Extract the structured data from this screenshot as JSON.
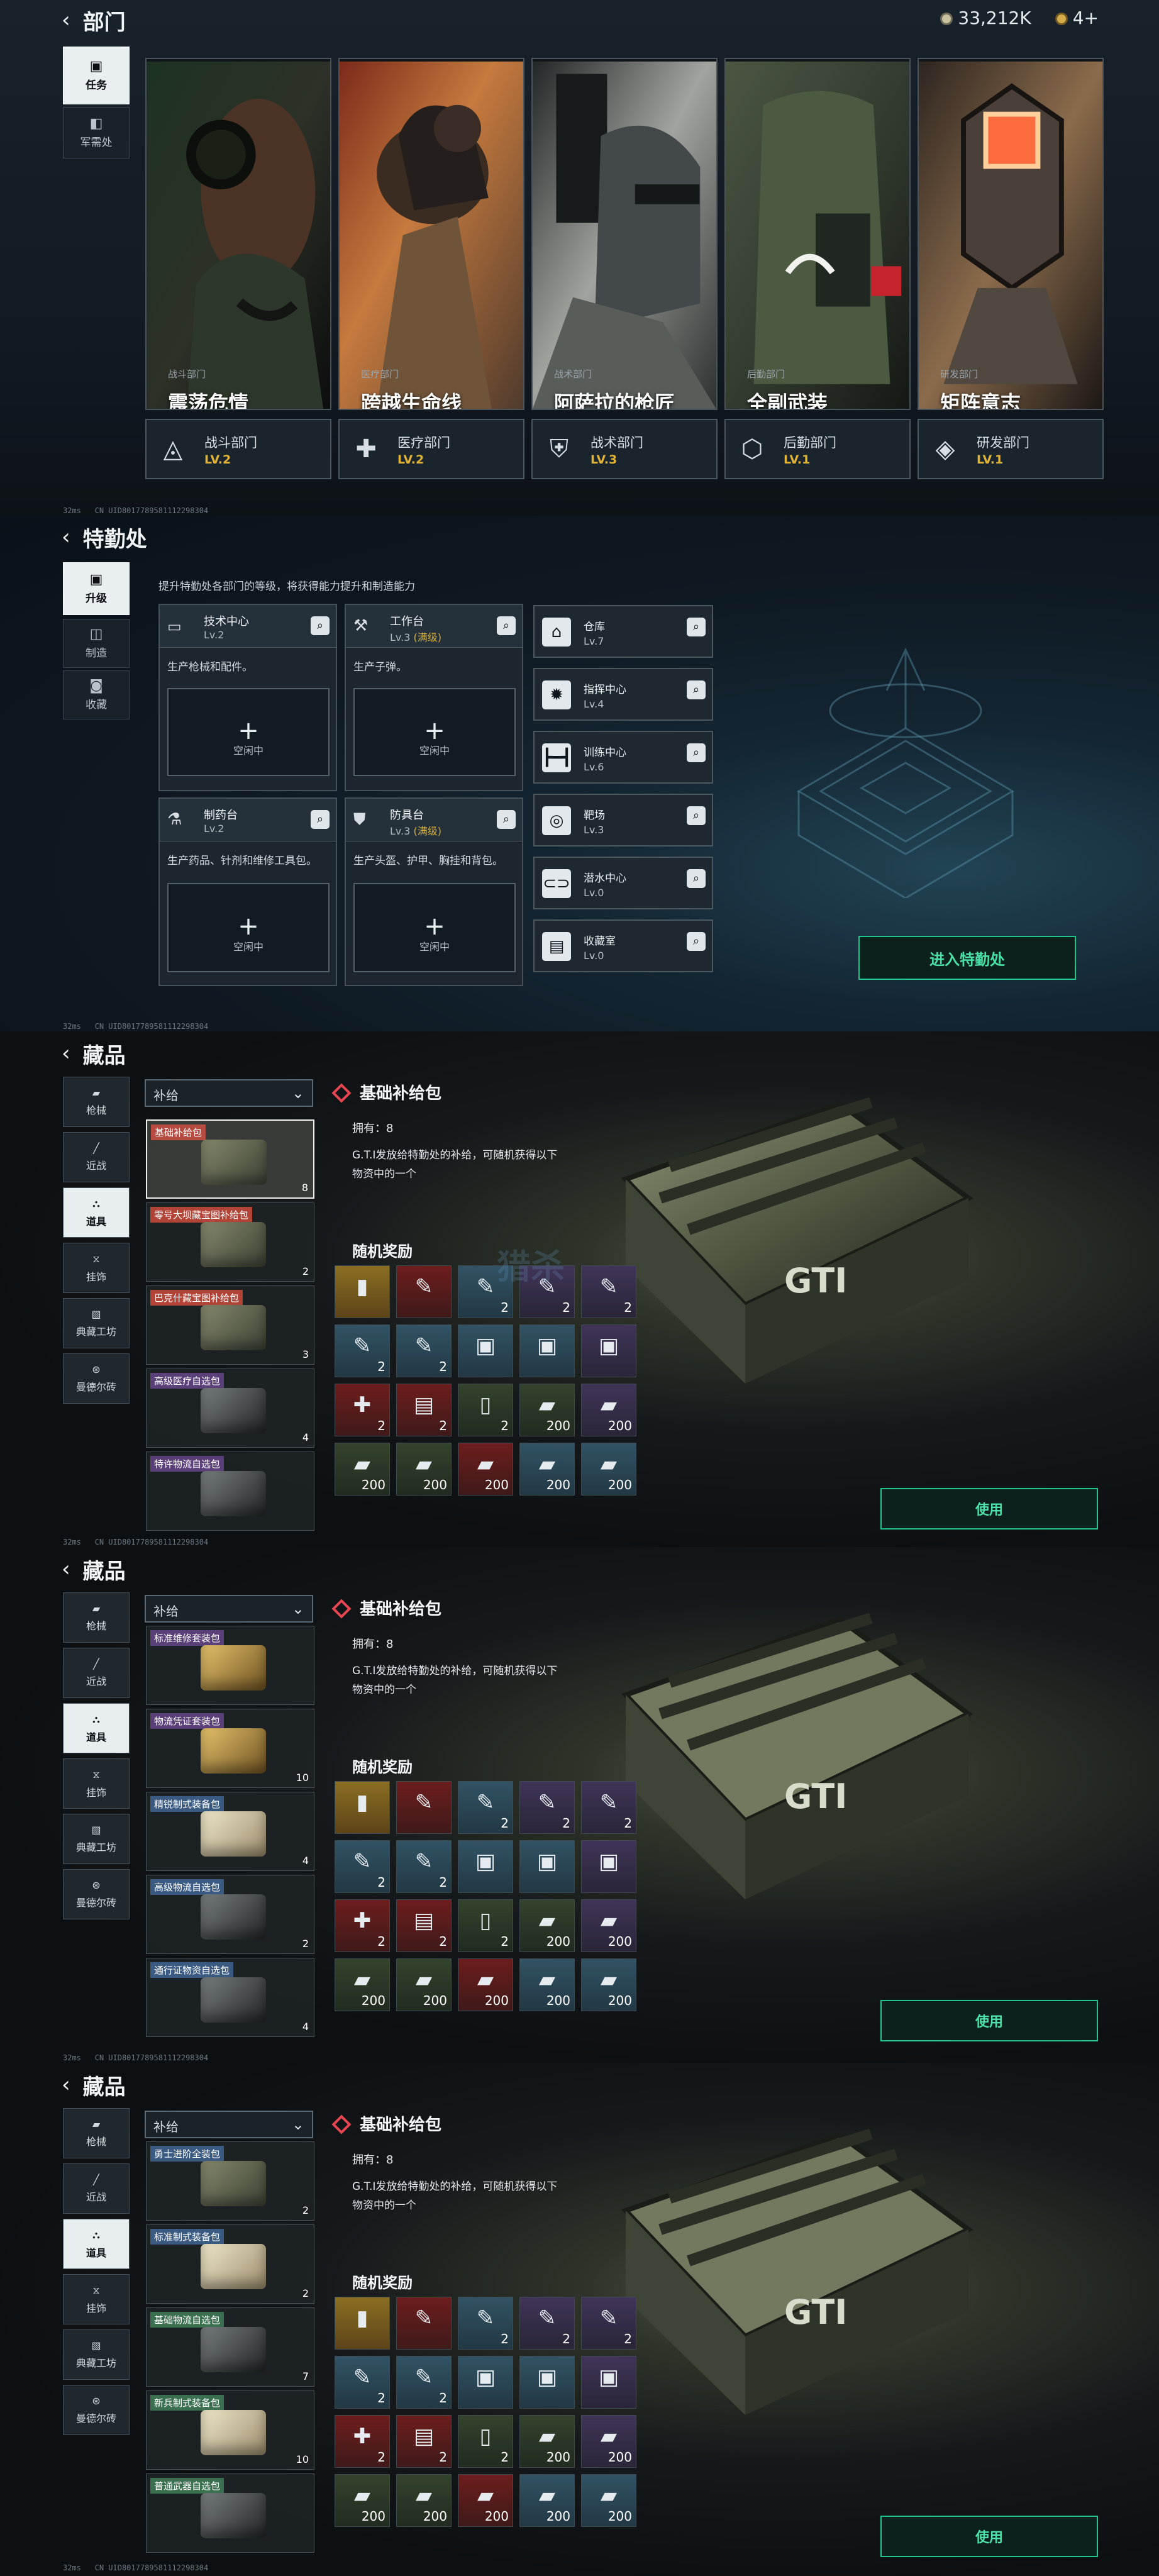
{
  "status": {
    "ping": "32ms",
    "code": "CN UID8017789581112298304"
  },
  "screen1": {
    "title": "部门",
    "currency_silver": "33,212K",
    "currency_gold": "4+",
    "tabs": [
      "任务",
      "军需处"
    ],
    "departments": [
      {
        "small": "战斗部门",
        "mission": "震荡危情",
        "name": "战斗部门",
        "level": "LV.2"
      },
      {
        "small": "医疗部门",
        "mission": "跨越生命线",
        "name": "医疗部门",
        "level": "LV.2"
      },
      {
        "small": "战术部门",
        "mission": "阿萨拉的枪匠",
        "name": "战术部门",
        "level": "LV.3"
      },
      {
        "small": "后勤部门",
        "mission": "全副武装",
        "name": "后勤部门",
        "level": "LV.1"
      },
      {
        "small": "研发部门",
        "mission": "矩阵意志",
        "name": "研发部门",
        "level": "LV.1"
      }
    ]
  },
  "screen2": {
    "title": "特勤处",
    "tabs": [
      "升级",
      "制造",
      "收藏"
    ],
    "intro": "提升特勤处各部门的等级，将获得能力提升和制造能力",
    "main_facilities": [
      {
        "name": "技术中心",
        "level": "Lv.2",
        "max": "",
        "desc": "生产枪械和配件。",
        "idle": "空闲中"
      },
      {
        "name": "工作台",
        "level": "Lv.3",
        "max": "(满级)",
        "desc": "生产子弹。",
        "idle": "空闲中"
      },
      {
        "name": "制药台",
        "level": "Lv.2",
        "max": "",
        "desc": "生产药品、针剂和维修工具包。",
        "idle": "空闲中"
      },
      {
        "name": "防具台",
        "level": "Lv.3",
        "max": "(满级)",
        "desc": "生产头盔、护甲、胸挂和背包。",
        "idle": "空闲中"
      }
    ],
    "small_facilities": [
      {
        "name": "仓库",
        "level": "Lv.7"
      },
      {
        "name": "指挥中心",
        "level": "Lv.4"
      },
      {
        "name": "训练中心",
        "level": "Lv.6"
      },
      {
        "name": "靶场",
        "level": "Lv.3"
      },
      {
        "name": "潜水中心",
        "level": "Lv.0"
      },
      {
        "name": "收藏室",
        "level": "Lv.0"
      }
    ],
    "enter_button": "进入特勤处"
  },
  "inventory": {
    "title": "藏品",
    "categories": [
      "枪械",
      "近战",
      "道具",
      "挂饰",
      "典藏工坊",
      "曼德尔砖"
    ],
    "filter": "补给",
    "detail_title": "基础补给包",
    "owned": "拥有：8",
    "desc": "G.T.I发放给特勤处的补给，可随机获得以下物资中的一个",
    "random": "随机奖励",
    "use": "使用",
    "watermark": "猎杀",
    "items_1": [
      {
        "label": "基础补给包",
        "count": "8"
      },
      {
        "label": "零号大坝藏宝图补给包",
        "count": "2"
      },
      {
        "label": "巴克什藏宝图补给包",
        "count": "3"
      },
      {
        "label": "高级医疗自选包",
        "count": "4"
      },
      {
        "label": "特许物流自选包",
        "count": ""
      }
    ],
    "items_2": [
      {
        "label": "标准维修套装包",
        "count": ""
      },
      {
        "label": "物流凭证套装包",
        "count": "10"
      },
      {
        "label": "精锐制式装备包",
        "count": "4"
      },
      {
        "label": "高级物流自选包",
        "count": "2"
      },
      {
        "label": "通行证物资自选包",
        "count": "4"
      }
    ],
    "items_3": [
      {
        "label": "勇士进阶全装包",
        "count": "2"
      },
      {
        "label": "标准制式装备包",
        "count": "2"
      },
      {
        "label": "基础物流自选包",
        "count": "7"
      },
      {
        "label": "新兵制式装备包",
        "count": "10"
      },
      {
        "label": "普通武器自选包",
        "count": ""
      }
    ],
    "reward_counts": [
      "2",
      "2",
      "2",
      "2",
      "2",
      "2",
      "2",
      "2",
      "2",
      "2",
      "2",
      "2",
      "2",
      "200",
      "200",
      "200",
      "200",
      "200",
      "200",
      "200"
    ]
  }
}
